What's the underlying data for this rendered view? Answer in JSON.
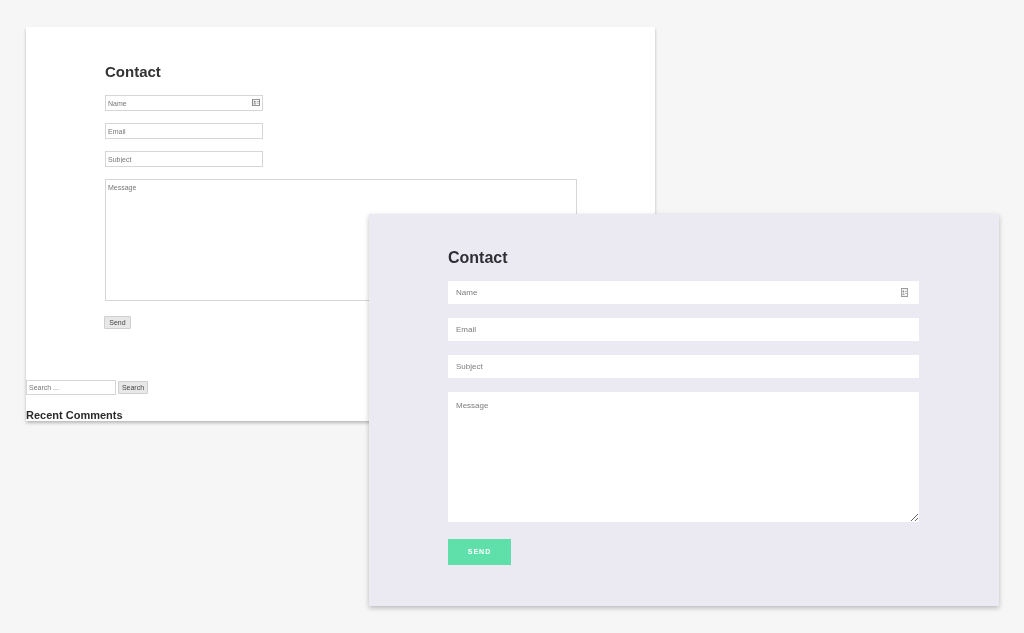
{
  "panels": [
    {
      "kind": "default",
      "heading": "Contact",
      "fields": [
        {
          "kind": "input",
          "placeholder": "Name",
          "autofill_icon": true
        },
        {
          "kind": "input",
          "placeholder": "Email",
          "autofill_icon": false
        },
        {
          "kind": "input",
          "placeholder": "Subject",
          "autofill_icon": false
        },
        {
          "kind": "textarea",
          "placeholder": "Message",
          "autofill_icon": false
        }
      ],
      "button": "Send",
      "search": {
        "placeholder": "Search ...",
        "button": "Search"
      },
      "widget_heading": "Recent Comments"
    },
    {
      "kind": "styled",
      "heading": "Contact",
      "fields": [
        {
          "kind": "input",
          "placeholder": "Name",
          "autofill_icon": true
        },
        {
          "kind": "input",
          "placeholder": "Email",
          "autofill_icon": false
        },
        {
          "kind": "input",
          "placeholder": "Subject",
          "autofill_icon": false
        },
        {
          "kind": "textarea",
          "placeholder": "Message",
          "autofill_icon": false
        }
      ],
      "button": "SEND"
    }
  ]
}
